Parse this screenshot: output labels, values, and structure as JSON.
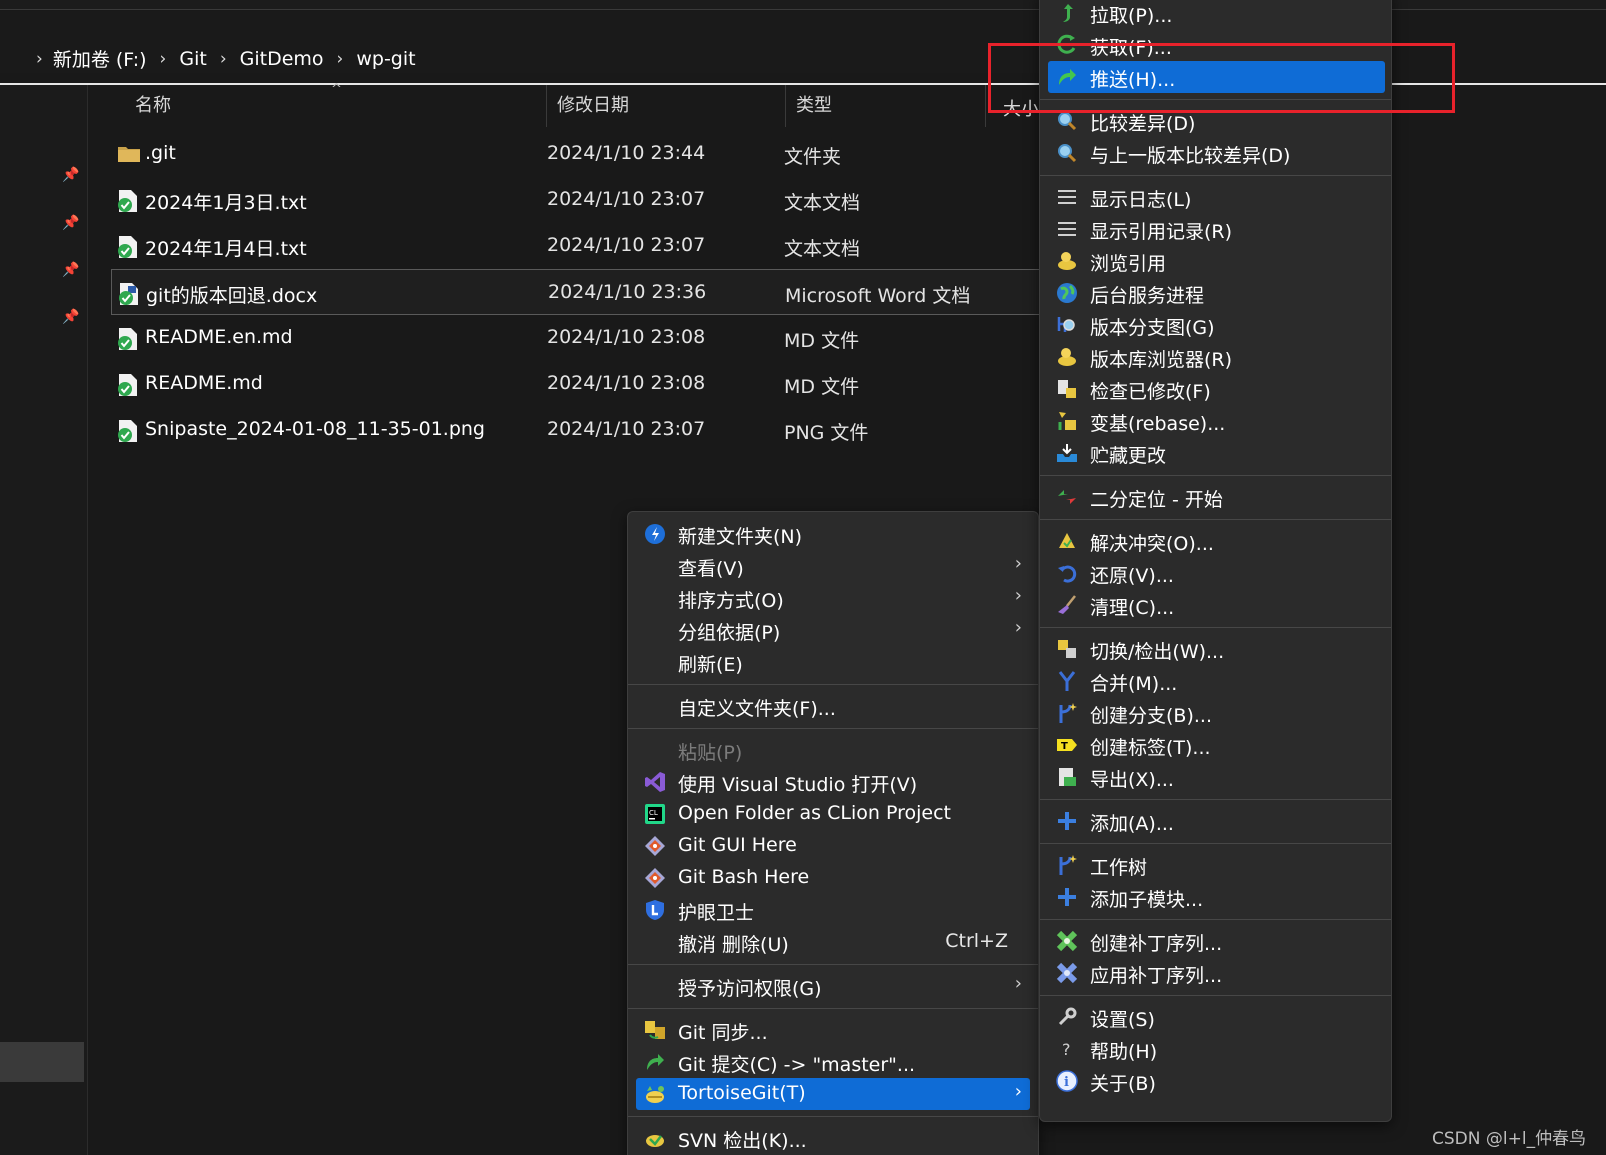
{
  "breadcrumb": [
    "新加卷 (F:)",
    "Git",
    "GitDemo",
    "wp-git"
  ],
  "columns": {
    "name": "名称",
    "date": "修改日期",
    "type": "类型",
    "size": "大小"
  },
  "files": [
    {
      "name": ".git",
      "date": "2024/1/10 23:44",
      "type": "文件夹",
      "icon": "folder-icon"
    },
    {
      "name": "2024年1月3日.txt",
      "date": "2024/1/10 23:07",
      "type": "文本文档",
      "icon": "git-synced-file-icon"
    },
    {
      "name": "2024年1月4日.txt",
      "date": "2024/1/10 23:07",
      "type": "文本文档",
      "icon": "git-synced-file-icon"
    },
    {
      "name": "git的版本回退.docx",
      "date": "2024/1/10 23:36",
      "type": "Microsoft Word 文档",
      "icon": "git-synced-file-icon"
    },
    {
      "name": "README.en.md",
      "date": "2024/1/10 23:08",
      "type": "MD 文件",
      "icon": "git-synced-file-icon"
    },
    {
      "name": "README.md",
      "date": "2024/1/10 23:08",
      "type": "MD 文件",
      "icon": "git-synced-file-icon"
    },
    {
      "name": "Snipaste_2024-01-08_11-35-01.png",
      "date": "2024/1/10 23:07",
      "type": "PNG 文件",
      "icon": "git-synced-file-icon"
    }
  ],
  "context_menu": [
    {
      "label": "新建文件夹(N)",
      "icon": "new-folder-icon"
    },
    {
      "label": "查看(V)",
      "submenu": true
    },
    {
      "label": "排序方式(O)",
      "submenu": true
    },
    {
      "label": "分组依据(P)",
      "submenu": true
    },
    {
      "label": "刷新(E)"
    },
    {
      "label": "自定义文件夹(F)..."
    },
    {
      "label": "粘贴(P)",
      "disabled": true
    },
    {
      "label": "使用 Visual Studio 打开(V)",
      "icon": "visual-studio-icon"
    },
    {
      "label": "Open Folder as CLion Project",
      "icon": "clion-icon"
    },
    {
      "label": "Git GUI Here",
      "icon": "git-gui-icon"
    },
    {
      "label": "Git Bash Here",
      "icon": "git-bash-icon"
    },
    {
      "label": "护眼卫士",
      "icon": "eye-guard-icon"
    },
    {
      "label": "撤消 删除(U)",
      "shortcut": "Ctrl+Z"
    },
    {
      "label": "授予访问权限(G)",
      "submenu": true
    },
    {
      "label": "Git 同步...",
      "icon": "git-sync-icon"
    },
    {
      "label": "Git 提交(C) -> \"master\"...",
      "icon": "git-commit-icon"
    },
    {
      "label": "TortoiseGit(T)",
      "icon": "tortoisegit-icon",
      "submenu": true,
      "highlighted": true
    },
    {
      "label": "SVN 检出(K)...",
      "icon": "svn-checkout-icon"
    }
  ],
  "tortoise_menu": [
    {
      "label": "拉取(P)...",
      "icon": "pull-icon"
    },
    {
      "label": "获取(F)...",
      "icon": "fetch-icon"
    },
    {
      "label": "推送(H)...",
      "icon": "push-icon",
      "highlighted": true
    },
    {
      "label": "比较差异(D)",
      "icon": "diff-icon"
    },
    {
      "label": "与上一版本比较差异(D)",
      "icon": "diff-previous-icon"
    },
    {
      "label": "显示日志(L)",
      "icon": "log-icon"
    },
    {
      "label": "显示引用记录(R)",
      "icon": "reflog-icon"
    },
    {
      "label": "浏览引用",
      "icon": "browse-refs-icon"
    },
    {
      "label": "后台服务进程",
      "icon": "daemon-globe-icon"
    },
    {
      "label": "版本分支图(G)",
      "icon": "revision-graph-icon"
    },
    {
      "label": "版本库浏览器(R)",
      "icon": "repo-browser-icon"
    },
    {
      "label": "检查已修改(F)",
      "icon": "check-modifications-icon"
    },
    {
      "label": "变基(rebase)...",
      "icon": "rebase-icon"
    },
    {
      "label": "贮藏更改",
      "icon": "stash-icon"
    },
    {
      "label": "二分定位 - 开始",
      "icon": "bisect-icon"
    },
    {
      "label": "解决冲突(O)...",
      "icon": "resolve-icon"
    },
    {
      "label": "还原(V)...",
      "icon": "revert-icon"
    },
    {
      "label": "清理(C)...",
      "icon": "cleanup-broom-icon"
    },
    {
      "label": "切换/检出(W)...",
      "icon": "switch-icon"
    },
    {
      "label": "合并(M)...",
      "icon": "merge-icon"
    },
    {
      "label": "创建分支(B)...",
      "icon": "branch-icon"
    },
    {
      "label": "创建标签(T)...",
      "icon": "tag-icon"
    },
    {
      "label": "导出(X)...",
      "icon": "export-icon"
    },
    {
      "label": "添加(A)...",
      "icon": "add-icon"
    },
    {
      "label": "工作树",
      "icon": "worktree-icon"
    },
    {
      "label": "添加子模块...",
      "icon": "add-submodule-icon"
    },
    {
      "label": "创建补丁序列...",
      "icon": "create-patch-icon"
    },
    {
      "label": "应用补丁序列...",
      "icon": "apply-patch-icon"
    },
    {
      "label": "设置(S)",
      "icon": "settings-wrench-icon"
    },
    {
      "label": "帮助(H)",
      "icon": "help-icon"
    },
    {
      "label": "关于(B)",
      "icon": "about-info-icon"
    }
  ],
  "watermark": "CSDN @l+l_仲春鸟",
  "colors": {
    "highlight": "#0f6cd6",
    "annotation_box": "#e8222b",
    "menu_bg": "#2b2b2b",
    "window_bg": "#191919"
  }
}
